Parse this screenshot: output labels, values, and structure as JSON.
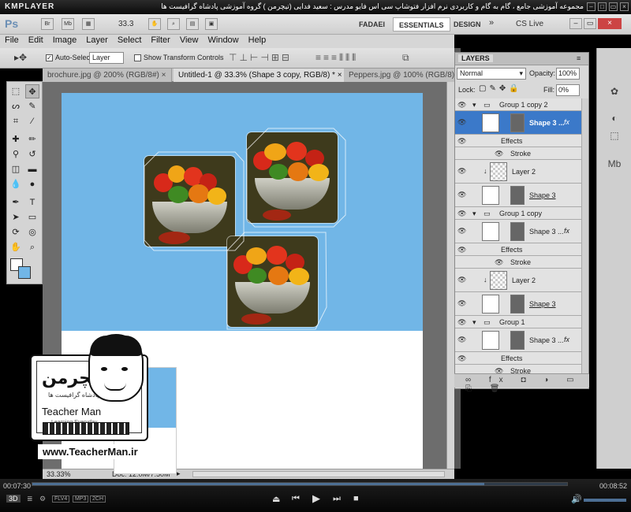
{
  "player": {
    "name": "KMPLAYER",
    "window_title": "مجموعه آموزشی جامع ، گام به گام و کاربردی نرم افزار فتوشاپ سی اس فایو   مدرس : سعید فدایی (تیچرمن ) گروه آموزشی پادشاه گرافیست ها",
    "time_elapsed": "00:07:30",
    "time_total": "00:08:52",
    "badges": [
      "3D",
      "FLV4",
      "MP3",
      "2CH"
    ]
  },
  "app_bar": {
    "logo": "Ps",
    "bridge": "Br",
    "minibridge": "Mb",
    "zoom": "33.3",
    "workspaces": [
      "FADAEI",
      "ESSENTIALS",
      "DESIGN"
    ],
    "active_workspace": "ESSENTIALS",
    "cs_live": "CS Live"
  },
  "menu": [
    "File",
    "Edit",
    "Image",
    "Layer",
    "Select",
    "Filter",
    "View",
    "Window",
    "Help"
  ],
  "options": {
    "auto_select_label": "Auto-Select:",
    "auto_select_value": "Layer",
    "show_transform_label": "Show Transform Controls"
  },
  "tabs": [
    {
      "label": "brochure.jpg @ 200% (RGB/8#)"
    },
    {
      "label": "Untitled-1 @ 33.3% (Shape 3 copy, RGB/8) *"
    },
    {
      "label": "Peppers.jpg @ 100% (RGB/8)"
    }
  ],
  "status": {
    "zoom": "33.33%",
    "doc": "Doc: 12.0M/7.50M"
  },
  "layers_panel": {
    "title": "LAYERS",
    "blend_mode": "Normal",
    "opacity_label": "Opacity:",
    "opacity": "100%",
    "lock_label": "Lock:",
    "fill_label": "Fill:",
    "fill": "0%",
    "rows": [
      {
        "type": "group",
        "name": "Group 1 copy 2"
      },
      {
        "type": "shape",
        "name": "Shape 3 ...",
        "selected": true
      },
      {
        "type": "effects",
        "name": "Effects"
      },
      {
        "type": "effect",
        "name": "Stroke"
      },
      {
        "type": "image",
        "name": "Layer 2"
      },
      {
        "type": "shape",
        "name": "Shape 3"
      },
      {
        "type": "group",
        "name": "Group 1 copy"
      },
      {
        "type": "shape",
        "name": "Shape 3 ..."
      },
      {
        "type": "effects",
        "name": "Effects"
      },
      {
        "type": "effect",
        "name": "Stroke"
      },
      {
        "type": "image",
        "name": "Layer 2"
      },
      {
        "type": "shape",
        "name": "Shape 3"
      },
      {
        "type": "group",
        "name": "Group 1"
      },
      {
        "type": "shape",
        "name": "Shape 3 ..."
      },
      {
        "type": "effects",
        "name": "Effects"
      },
      {
        "type": "effect",
        "name": "Stroke"
      }
    ]
  },
  "watermark": {
    "brand_fa": "تیچرمن",
    "brand_sub": "پادشاه گرافیست ها",
    "name": "Teacher Man",
    "tagline": "Learning Everyday",
    "url": "www.TeacherMan.ir"
  },
  "colors": {
    "canvas_blue": "#71b6e7",
    "selected_layer": "#3b79c9"
  }
}
